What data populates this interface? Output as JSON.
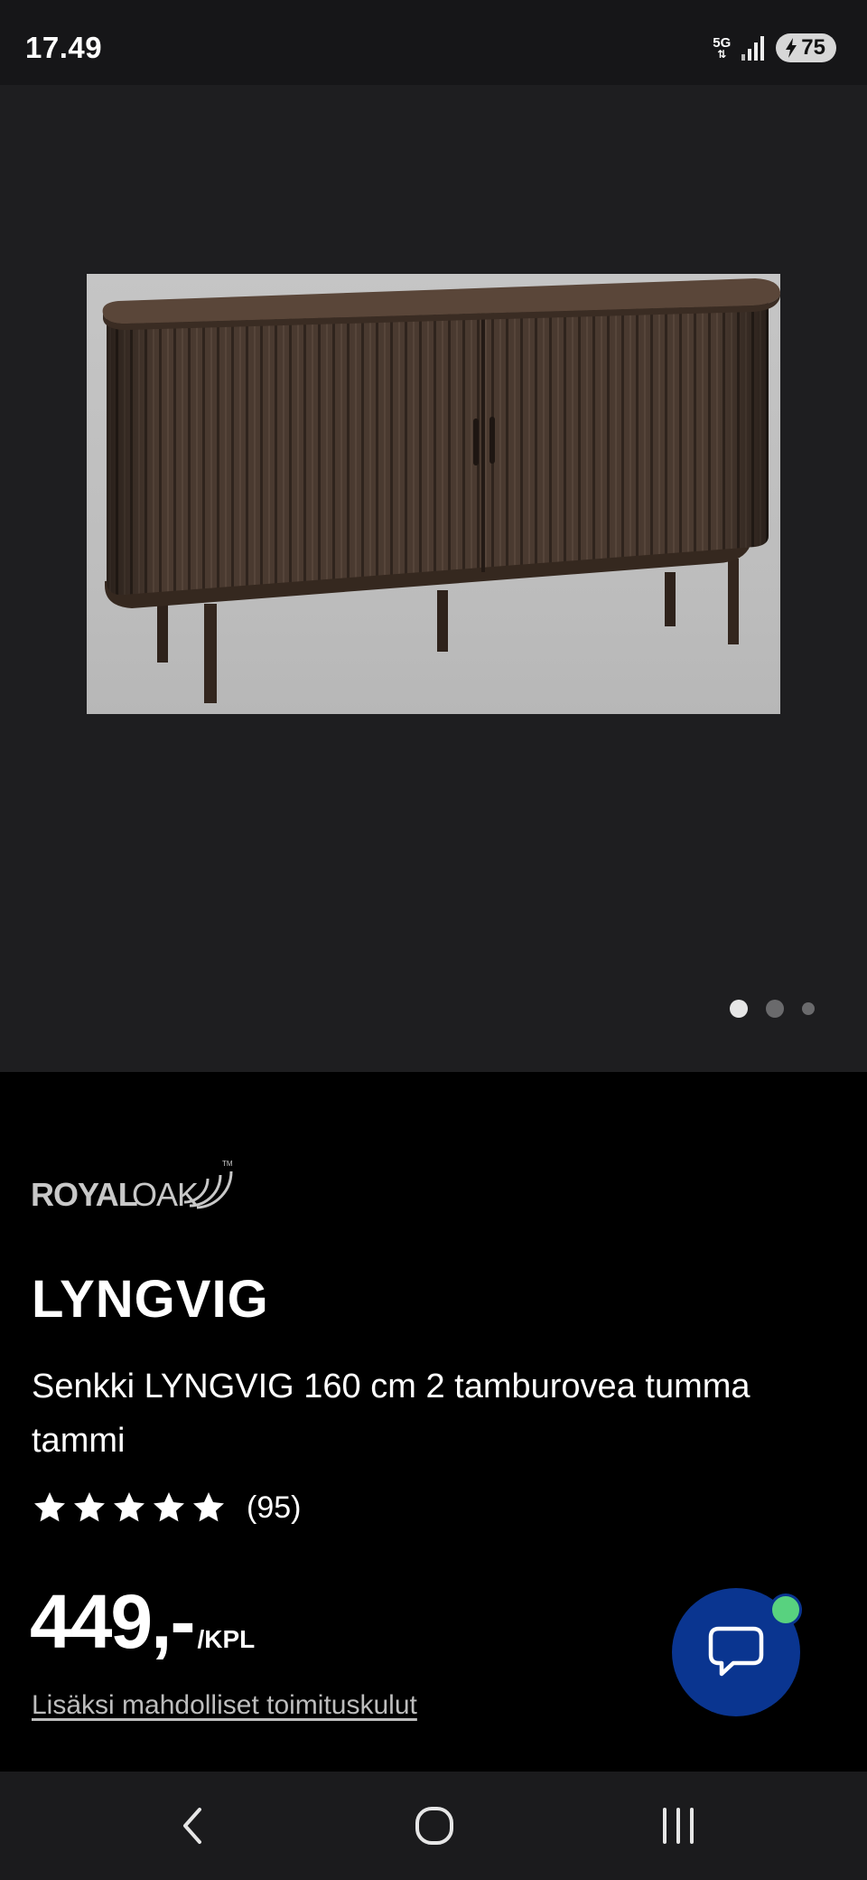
{
  "status_bar": {
    "time": "17.49",
    "network_label": "5G",
    "battery_level": "75",
    "icons": [
      "5g-icon",
      "signal-icon",
      "battery-charging-icon"
    ]
  },
  "gallery": {
    "image_count": 3,
    "active_index": 0
  },
  "product": {
    "brand": "ROYAL OAK",
    "name": "LYNGVIG",
    "description": "Senkki LYNGVIG 160 cm 2 tamburovea tumma tammi",
    "rating_stars": 5,
    "review_count": "(95)",
    "price": "449,-",
    "price_unit": "/KPL",
    "shipping_note": "Lisäksi mahdolliset toimituskulut"
  },
  "chat": {
    "icon": "chat-bubble-icon",
    "online_color": "#58d27f",
    "button_color": "#0a3590"
  },
  "navigation": {
    "icons": [
      "back-icon",
      "home-icon",
      "recents-icon"
    ]
  }
}
